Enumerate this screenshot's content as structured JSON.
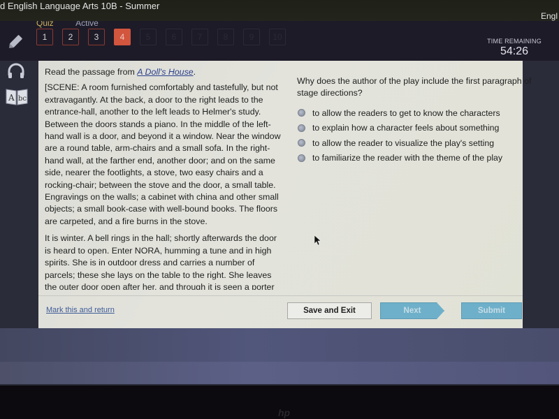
{
  "window": {
    "title": "d English Language Arts 10B - Summer",
    "right_label": "Engl"
  },
  "header": {
    "subtabs": [
      "Quiz",
      "Active"
    ],
    "question_nav": [
      {
        "label": "1",
        "state": "answered"
      },
      {
        "label": "2",
        "state": "answered"
      },
      {
        "label": "3",
        "state": "answered"
      },
      {
        "label": "4",
        "state": "current"
      },
      {
        "label": "5",
        "state": "locked"
      },
      {
        "label": "6",
        "state": "locked"
      },
      {
        "label": "7",
        "state": "locked"
      },
      {
        "label": "8",
        "state": "locked"
      },
      {
        "label": "9",
        "state": "locked"
      },
      {
        "label": "10",
        "state": "locked"
      }
    ],
    "timer": {
      "label": "TIME REMAINING",
      "value": "54:26"
    }
  },
  "tools": [
    {
      "name": "pencil",
      "icon": "pencil-icon"
    },
    {
      "name": "audio",
      "icon": "headphones-icon"
    },
    {
      "name": "dictionary",
      "icon": "dictionary-abc-icon"
    }
  ],
  "passage": {
    "intro_prefix": "Read the passage from ",
    "intro_title": "A Doll's House",
    "intro_suffix": ".",
    "paragraphs": [
      "[SCENE: A room furnished comfortably and tastefully, but not extravagantly. At the back, a door to the right leads to the entrance-hall, another to the left leads to Helmer's study. Between the doors stands a piano. In the middle of the left-hand wall is a door, and beyond it a window. Near the window are a round table, arm-chairs and a small sofa. In the right-hand wall, at the farther end, another door; and on the same side, nearer the footlights, a stove, two easy chairs and a rocking-chair; between the stove and the door, a small table. Engravings on the walls; a cabinet with china and other small objects; a small book-case with well-bound books. The floors are carpeted, and a fire burns in the stove.",
      "It is winter. A bell rings in the hall; shortly afterwards the door is heard to open. Enter NORA, humming a tune and in high spirits. She is in outdoor dress and carries a number of parcels; these she lays on the table to the right. She leaves the outer door open after her, and through it is seen a porter"
    ]
  },
  "question": {
    "prompt": "Why does the author of the play include the first paragraph of stage directions?",
    "options": [
      "to allow the readers to get to know the characters",
      "to explain how a character feels about something",
      "to allow the reader to visualize the play's setting",
      "to familiarize the reader with the theme of the play"
    ],
    "selected": null
  },
  "footer": {
    "mark_link": "Mark this and return",
    "save_exit": "Save and Exit",
    "next": "Next",
    "submit": "Submit"
  },
  "colors": {
    "current_question": "#d2553e",
    "answered_border": "#8b3a2f",
    "action_button": "#6eb0ca",
    "link": "#3d5b97"
  }
}
